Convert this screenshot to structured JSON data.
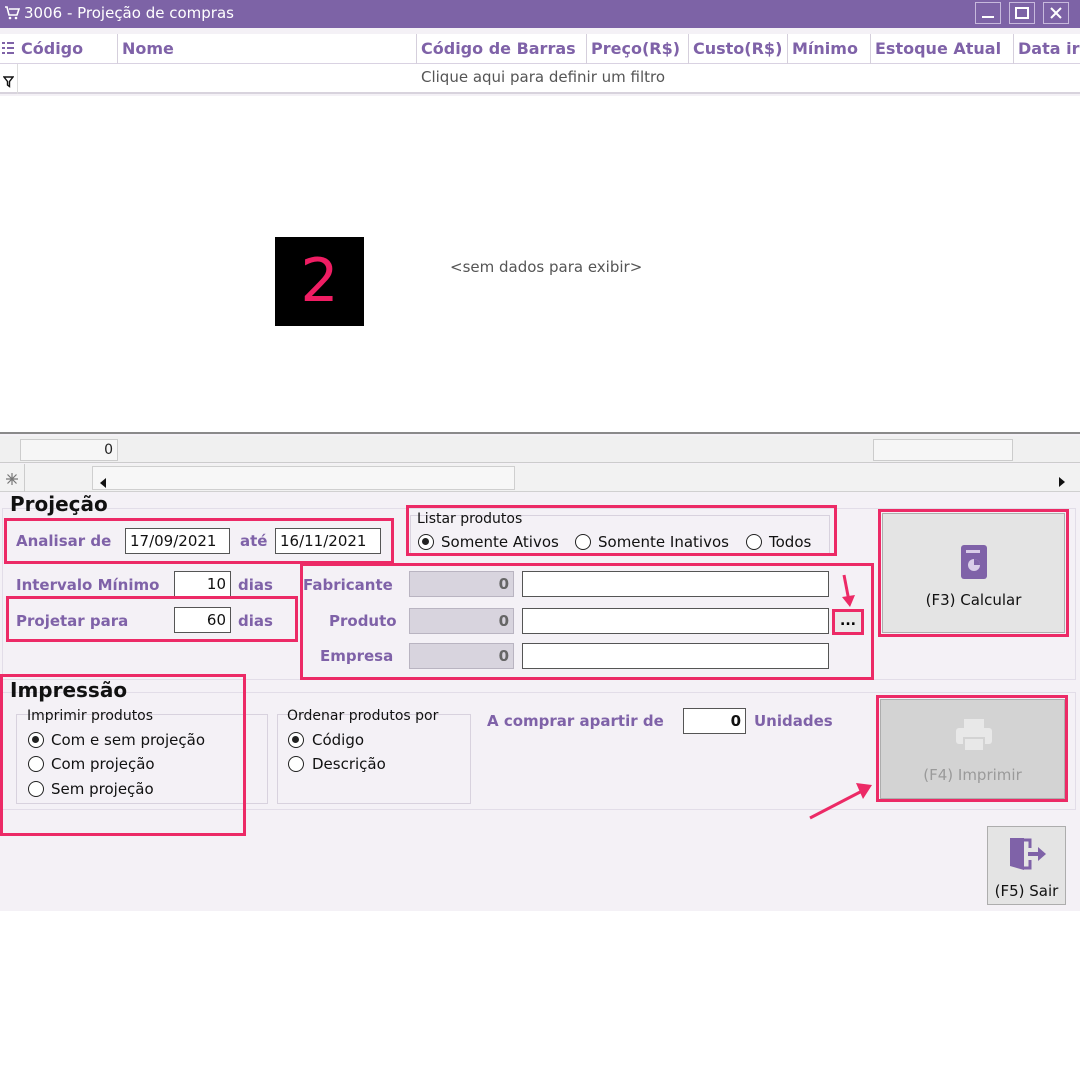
{
  "window": {
    "title": "3006 - Projeção de compras"
  },
  "grid": {
    "columns": [
      "Código",
      "Nome",
      "Código de Barras",
      "Preço(R$)",
      "Custo(R$)",
      "Mínimo",
      "Estoque Atual",
      "Data ir"
    ],
    "filter_hint": "Clique aqui para definir um filtro",
    "empty_text": "<sem dados para exibir>",
    "footer_count": "0",
    "annotation_number": "2"
  },
  "projecao": {
    "section_title": "Projeção",
    "analisar_de_label": "Analisar de",
    "date_from": "17/09/2021",
    "ate_label": "até",
    "date_to": "16/11/2021",
    "intervalo_label": "Intervalo Mínimo",
    "intervalo_value": "10",
    "dias_label": "dias",
    "projetar_label": "Projetar para",
    "projetar_value": "60",
    "listar_group": "Listar produtos",
    "listar_options": [
      "Somente Ativos",
      "Somente Inativos",
      "Todos"
    ],
    "listar_selected": "Somente Ativos",
    "fabricante_label": "Fabricante",
    "fabricante_code": "0",
    "produto_label": "Produto",
    "produto_code": "0",
    "empresa_label": "Empresa",
    "empresa_code": "0",
    "ellipsis": "...",
    "calcular_button": "(F3) Calcular"
  },
  "impressao": {
    "section_title": "Impressão",
    "imprimir_group": "Imprimir produtos",
    "imprimir_options": [
      "Com e sem projeção",
      "Com projeção",
      "Sem projeção"
    ],
    "imprimir_selected": "Com e sem projeção",
    "ordenar_group": "Ordenar produtos por",
    "ordenar_options": [
      "Código",
      "Descrição"
    ],
    "ordenar_selected": "Código",
    "comprar_label": "A comprar apartir de",
    "comprar_value": "0",
    "unidades_label": "Unidades",
    "imprimir_button": "(F4) Imprimir",
    "sair_button": "(F5) Sair"
  },
  "colors": {
    "title_bar": "#7d63a6",
    "label_purple": "#7f62a8",
    "highlight_pink": "#ec2a66",
    "window_bg": "#f4f1f6"
  },
  "icons": [
    "cart-icon",
    "minimize-icon",
    "maximize-icon",
    "close-icon",
    "column-chooser-icon",
    "filter-icon",
    "new-row-icon",
    "scroll-left-icon",
    "scroll-right-icon",
    "calculator-icon",
    "printer-icon",
    "exit-door-icon"
  ]
}
